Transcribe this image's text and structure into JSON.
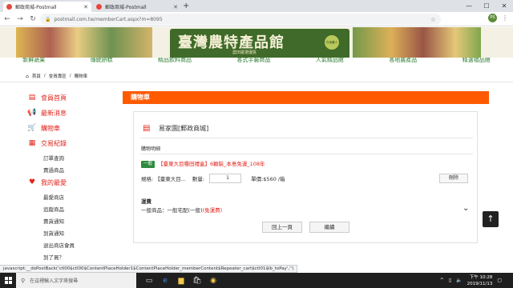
{
  "browser": {
    "tabs": [
      {
        "title": "郵政商城-Postmall",
        "active": true
      },
      {
        "title": "郵政商城-Postmall",
        "active": false
      }
    ],
    "url": "postmall.com.tw/memberCart.aspx?m=8095",
    "profile_initials": "PS"
  },
  "banner": {
    "title": "臺灣農特產品館",
    "subtitle": "農田嚴選優質",
    "seal": "在地農人",
    "categories": [
      "新鮮蔬果",
      "傳統餅糕",
      "精品飲料商品",
      "各式手藝商品",
      "人氣精品館",
      "各地農產品",
      "精選禮品館"
    ]
  },
  "breadcrumb": {
    "home": "首頁",
    "level1": "會員專區",
    "level2": "購物車"
  },
  "sidebar": {
    "items": [
      {
        "label": "會員首頁",
        "icon": "member-card-icon"
      },
      {
        "label": "最新消息",
        "icon": "megaphone-icon"
      },
      {
        "label": "購物車",
        "icon": "cart-icon"
      },
      {
        "label": "交易紀錄",
        "icon": "record-icon"
      }
    ],
    "record_subs": [
      "訂單查詢",
      "賣過商品"
    ],
    "favorites_label": "我的最愛",
    "favorites_subs": [
      "最愛商店",
      "追蹤商品",
      "賣貨通知",
      "到貨通知",
      "退出商店會員",
      "到了買？"
    ]
  },
  "cart": {
    "header": "購物車",
    "store": "易家園[郵政商城]",
    "detail_label": "購物明細",
    "badge": "一般",
    "product": "【臺東大目種田禮盒】6顆裝_本島免運_108年",
    "spec_label": "規格:",
    "spec_value": "【臺東大目...",
    "qty_label": "數量:",
    "qty_value": "1",
    "price_label": "單價:$560 /箱",
    "delete_label": "刪除",
    "shipping_label": "運費",
    "shipping_text": "一般商品：一般宅配(一般)",
    "shipping_free": "(免運費)",
    "back_label": "回上一頁",
    "continue_label": "繼續"
  },
  "status_text": "javascript:__doPostBack('ctl00$ctl00$ContentPlaceHolder1$ContentPlaceHolder_memberContent$Repeater_cart$ctl01$lb_toPay','')",
  "taskbar": {
    "search_placeholder": "在這裡輸入文字來搜尋",
    "time": "下午 10:28",
    "date": "2019/11/13"
  }
}
